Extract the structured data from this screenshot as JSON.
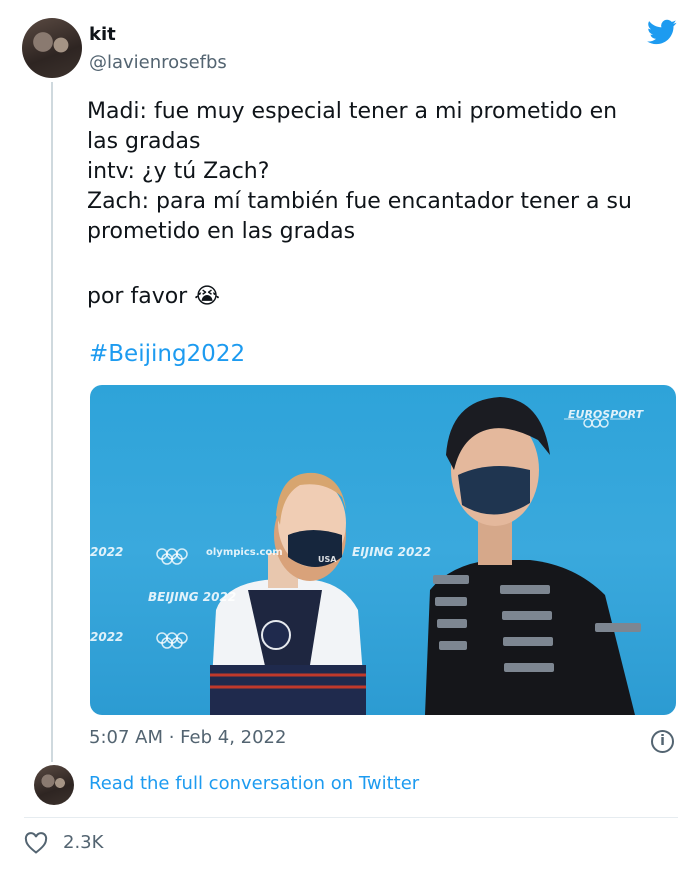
{
  "author": {
    "name": "kit",
    "handle": "@lavienrosefbs"
  },
  "tweet": {
    "lines": [
      "Madi: fue muy especial tener a mi prometido en",
      "las gradas",
      "intv: ¿y tú Zach?",
      "Zach: para mí también fue encantador tener a su",
      "prometido en las gradas",
      "",
      "por favor"
    ],
    "emoji": "😭",
    "hashtag": "#Beijing2022",
    "timestamp": "5:07 AM · Feb 4, 2022"
  },
  "media": {
    "broadcaster": "EUROSPORT",
    "backdrop_text": {
      "year": "2022",
      "site": "olympics.com",
      "city": "BEIJING 2022",
      "city_short": "EIJING 2022"
    },
    "mask_text": "USA"
  },
  "footer": {
    "read_link": "Read the full conversation on Twitter",
    "like_count": "2.3K"
  },
  "colors": {
    "accent": "#1d9bf0",
    "secondary_text": "#536471"
  },
  "icons": [
    "twitter-bird-icon",
    "info-icon",
    "heart-icon"
  ]
}
